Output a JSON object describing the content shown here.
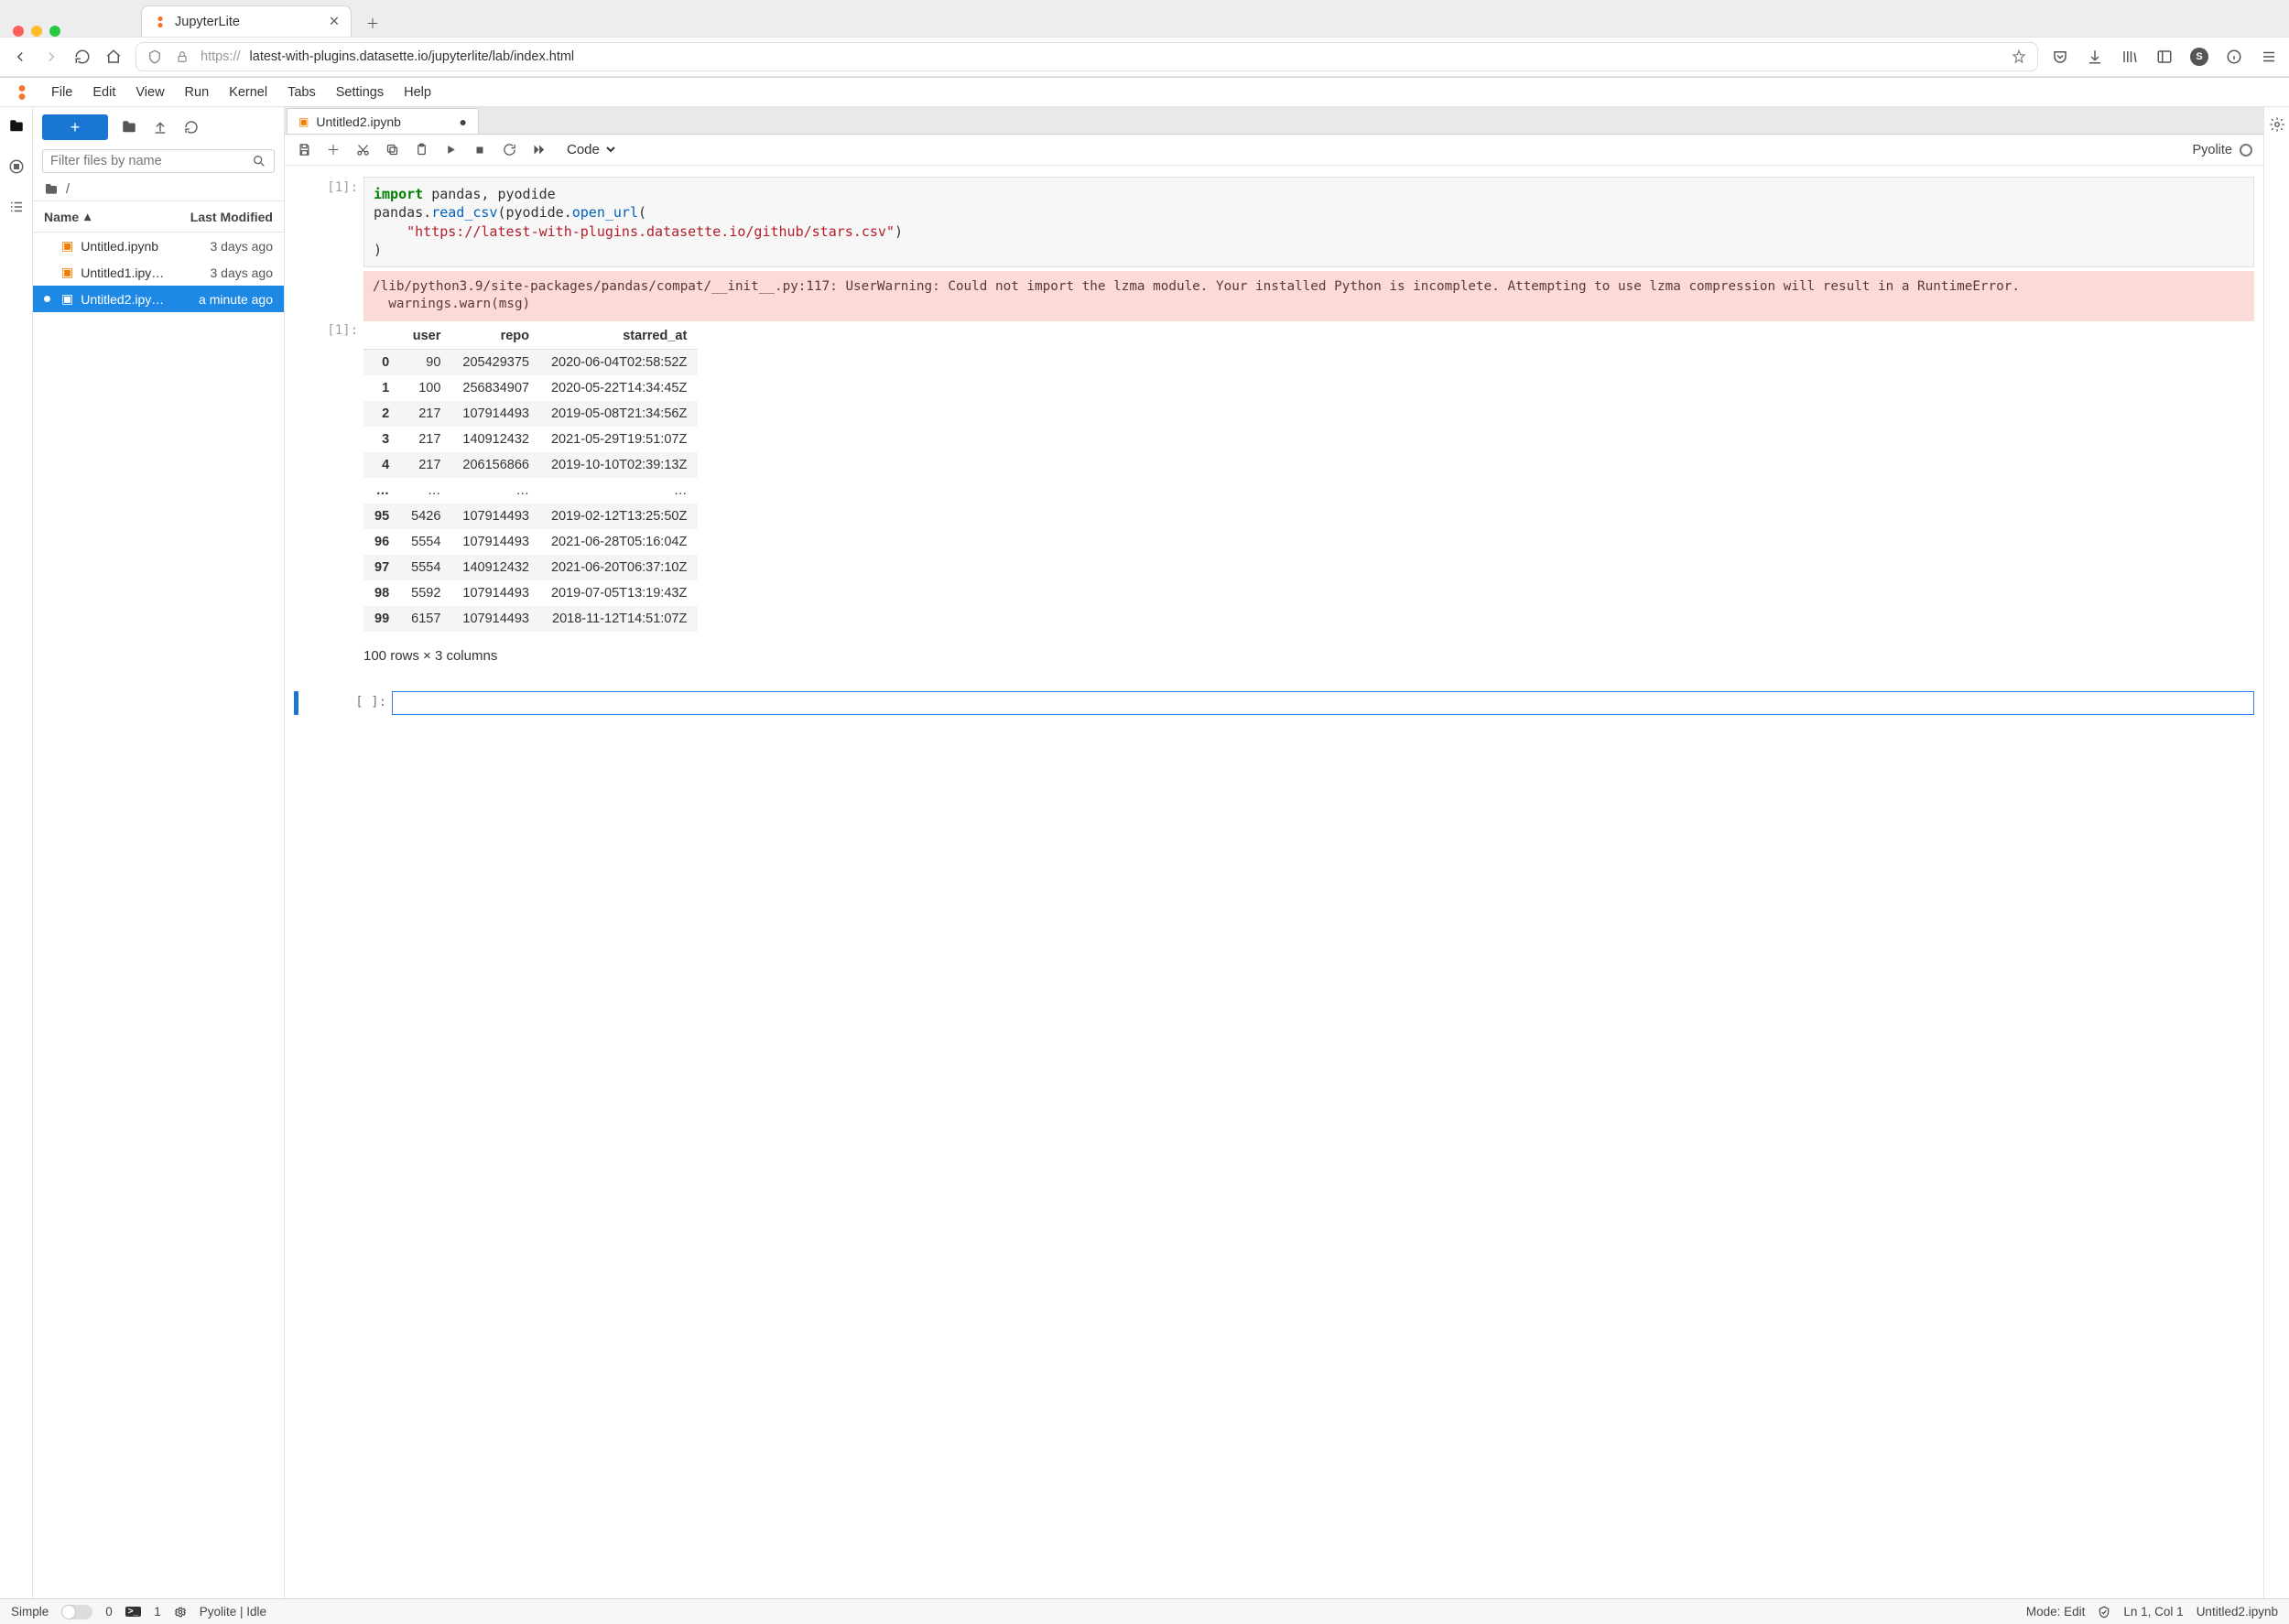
{
  "browser": {
    "tab_title": "JupyterLite",
    "url_proto": "https://",
    "url_rest": "latest-with-plugins.datasette.io/jupyterlite/lab/index.html"
  },
  "menubar": [
    "File",
    "Edit",
    "View",
    "Run",
    "Kernel",
    "Tabs",
    "Settings",
    "Help"
  ],
  "filebrowser": {
    "filter_placeholder": "Filter files by name",
    "crumb": "/",
    "col_name": "Name",
    "col_modified": "Last Modified",
    "files": [
      {
        "name": "Untitled.ipynb",
        "modified": "3 days ago",
        "selected": false,
        "unsaved": false
      },
      {
        "name": "Untitled1.ipy…",
        "modified": "3 days ago",
        "selected": false,
        "unsaved": false
      },
      {
        "name": "Untitled2.ipy…",
        "modified": "a minute ago",
        "selected": true,
        "unsaved": true
      }
    ]
  },
  "doc_tab": {
    "title": "Untitled2.ipynb"
  },
  "nb_toolbar": {
    "celltype": "Code",
    "kernel": "Pyolite"
  },
  "cell1": {
    "prompt": "[1]:",
    "line1_kw": "import",
    "line1_rest": " pandas, pyodide",
    "line2_pre": "pandas.",
    "line2_fn1": "read_csv",
    "line2_mid": "(pyodide.",
    "line2_fn2": "open_url",
    "line2_post": "(",
    "line3_str": "\"https://latest-with-plugins.datasette.io/github/stars.csv\"",
    "line3_post": ")",
    "line4": ")"
  },
  "warning": "/lib/python3.9/site-packages/pandas/compat/__init__.py:117: UserWarning: Could not import the lzma module. Your installed Python is incomplete. Attempting to use lzma compression will result in a RuntimeError.\n  warnings.warn(msg)",
  "out_prompt": "[1]:",
  "df": {
    "columns": [
      "",
      "user",
      "repo",
      "starred_at"
    ],
    "rows": [
      [
        "0",
        "90",
        "205429375",
        "2020-06-04T02:58:52Z"
      ],
      [
        "1",
        "100",
        "256834907",
        "2020-05-22T14:34:45Z"
      ],
      [
        "2",
        "217",
        "107914493",
        "2019-05-08T21:34:56Z"
      ],
      [
        "3",
        "217",
        "140912432",
        "2021-05-29T19:51:07Z"
      ],
      [
        "4",
        "217",
        "206156866",
        "2019-10-10T02:39:13Z"
      ],
      [
        "…",
        "…",
        "…",
        "…"
      ],
      [
        "95",
        "5426",
        "107914493",
        "2019-02-12T13:25:50Z"
      ],
      [
        "96",
        "5554",
        "107914493",
        "2021-06-28T05:16:04Z"
      ],
      [
        "97",
        "5554",
        "140912432",
        "2021-06-20T06:37:10Z"
      ],
      [
        "98",
        "5592",
        "107914493",
        "2019-07-05T13:19:43Z"
      ],
      [
        "99",
        "6157",
        "107914493",
        "2018-11-12T14:51:07Z"
      ]
    ],
    "caption": "100 rows × 3 columns"
  },
  "cell2_prompt": "[ ]:",
  "status": {
    "simple": "Simple",
    "tabs0": "0",
    "term1": "1",
    "kernel": "Pyolite | Idle",
    "mode": "Mode: Edit",
    "lncol": "Ln 1, Col 1",
    "file": "Untitled2.ipynb"
  },
  "avatar_letter": "S"
}
